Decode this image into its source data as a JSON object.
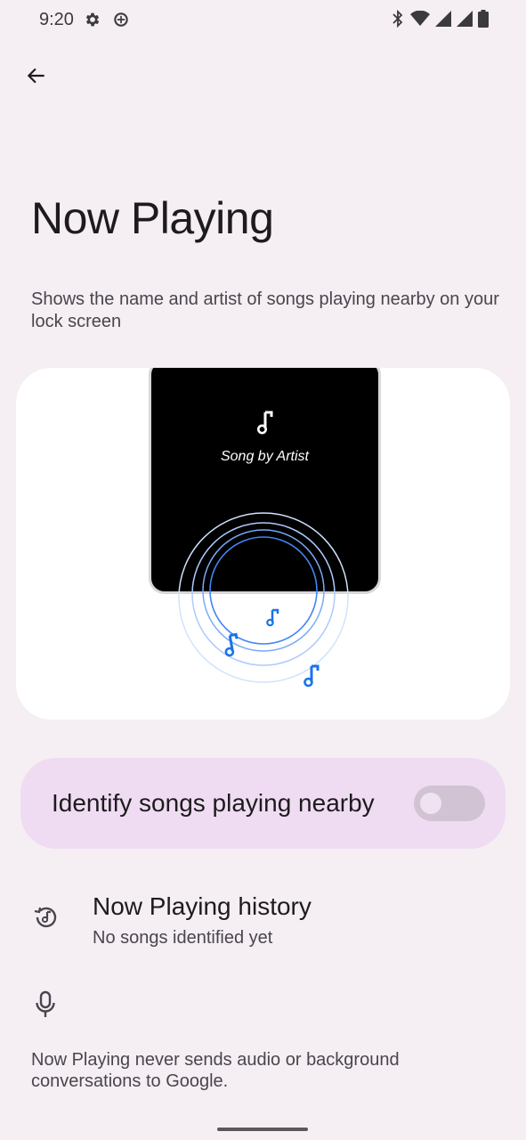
{
  "status_bar": {
    "time": "9:20",
    "left_icons": [
      "settings-icon",
      "data-saver-icon"
    ],
    "right_icons": [
      "bluetooth-icon",
      "wifi-icon",
      "signal-icon",
      "signal-icon",
      "battery-icon"
    ]
  },
  "header": {
    "back_icon": "arrow-back-icon",
    "title": "Now Playing",
    "description": "Shows the name and artist of songs playing nearby on your lock screen"
  },
  "illustration": {
    "caption": "Song by Artist",
    "icons": [
      "music-note-icon"
    ]
  },
  "toggle": {
    "label": "Identify songs playing nearby",
    "enabled": false
  },
  "history": {
    "icon": "history-music-icon",
    "title": "Now Playing history",
    "subtitle": "No songs identified yet"
  },
  "footer": {
    "icon": "mic-icon",
    "note": "Now Playing never sends audio or background conversations to Google."
  },
  "colors": {
    "background": "#f5eff3",
    "card_background": "#ffffff",
    "toggle_card": "#efdcf2",
    "switch_track": "#d1c3d3",
    "accent_blue": "#1a73e8"
  }
}
